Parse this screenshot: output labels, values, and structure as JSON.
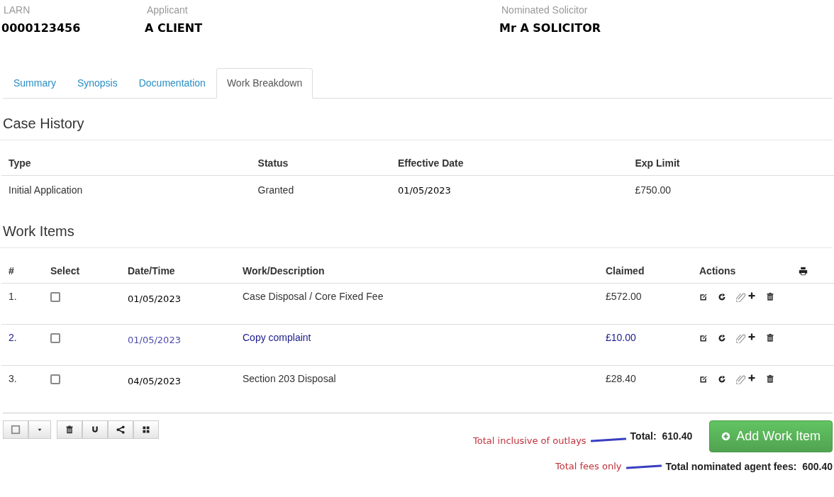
{
  "header": [
    {
      "label": "LARN",
      "value": "0000123456"
    },
    {
      "label": "Applicant",
      "value": "A CLIENT"
    },
    {
      "label": "Nominated Solicitor",
      "value": "Mr A SOLICITOR"
    }
  ],
  "tabs": [
    {
      "label": "Summary",
      "selected": false
    },
    {
      "label": "Synopsis",
      "selected": false
    },
    {
      "label": "Documentation",
      "selected": false
    },
    {
      "label": "Work Breakdown",
      "selected": true
    }
  ],
  "case_history": {
    "title": "Case History",
    "columns": [
      "Type",
      "Status",
      "Effective Date",
      "Exp Limit"
    ],
    "rows": [
      [
        "Initial Application",
        "Granted",
        "01/05/2023",
        "£750.00"
      ]
    ]
  },
  "work_items": {
    "title": "Work Items",
    "columns": [
      "#",
      "Select",
      "Date/Time",
      "Work/Description",
      "Claimed",
      "Actions"
    ],
    "rows": [
      {
        "number": "1.",
        "checked": false,
        "date": "01/05/2023",
        "description": "Case Disposal / Core Fixed Fee",
        "claimed": "£572.00",
        "highlighted": false
      },
      {
        "number": "2.",
        "checked": false,
        "date": "01/05/2023",
        "description": "Copy complaint",
        "claimed": "£10.00",
        "highlighted": true
      },
      {
        "number": "3.",
        "checked": false,
        "date": "04/05/2023",
        "description": "Section 203 Disposal",
        "claimed": "£28.40",
        "highlighted": false
      }
    ]
  },
  "totals": [
    {
      "annotation": "Total inclusive of outlays",
      "text": "Total:  610.40"
    },
    {
      "annotation": "Total fees only",
      "text": "Total nominated agent fees:  600.40"
    }
  ],
  "add_button": "Add Work Item"
}
